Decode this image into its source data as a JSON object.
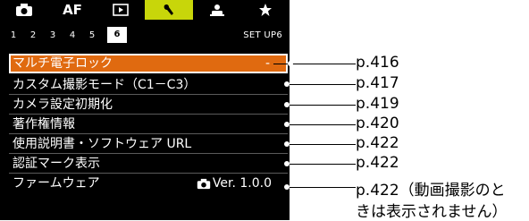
{
  "tabs": [
    {
      "icon": "camera-icon",
      "label": ""
    },
    {
      "icon": "",
      "label": "AF"
    },
    {
      "icon": "play-icon",
      "label": ""
    },
    {
      "icon": "wrench-icon",
      "label": ""
    },
    {
      "icon": "person-star-icon",
      "label": ""
    },
    {
      "icon": "star-icon",
      "label": ""
    }
  ],
  "pages": [
    "1",
    "2",
    "3",
    "4",
    "5",
    "6"
  ],
  "setup_label": "SET UP6",
  "menu_items": [
    {
      "label": "マルチ電子ロック",
      "value": "-",
      "ref": "p.416"
    },
    {
      "label": "カスタム撮影モード（C1－C3）",
      "value": "",
      "ref": "p.417"
    },
    {
      "label": "カメラ設定初期化",
      "value": "",
      "ref": "p.419"
    },
    {
      "label": "著作権情報",
      "value": "",
      "ref": "p.420"
    },
    {
      "label": "使用説明書・ソフトウェア URL",
      "value": "",
      "ref": "p.422"
    },
    {
      "label": "認証マーク表示",
      "value": "",
      "ref": "p.422"
    },
    {
      "label": "ファームウェア",
      "value": "Ver. 1.0.0",
      "ref": "p.422（動画撮影のと"
    }
  ],
  "ref_continuation": "きは表示されません）",
  "colors": {
    "accent_tab": "#c8d60a",
    "selected_row": "#e06a10",
    "background": "#000000"
  }
}
